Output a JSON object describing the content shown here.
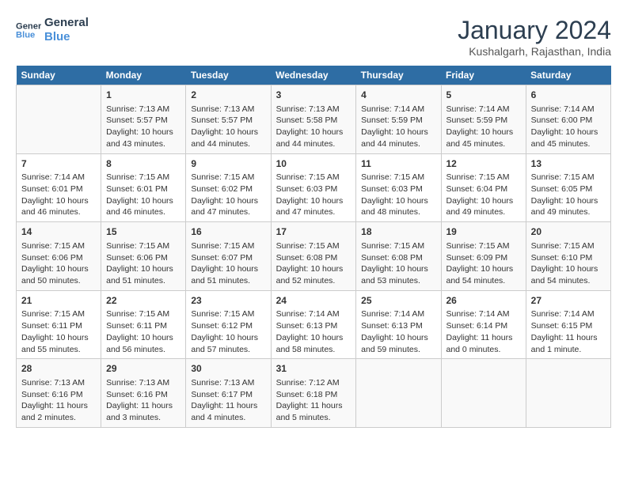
{
  "logo": {
    "line1": "General",
    "line2": "Blue"
  },
  "title": "January 2024",
  "subtitle": "Kushalgarh, Rajasthan, India",
  "days_of_week": [
    "Sunday",
    "Monday",
    "Tuesday",
    "Wednesday",
    "Thursday",
    "Friday",
    "Saturday"
  ],
  "weeks": [
    [
      {
        "day": "",
        "content": ""
      },
      {
        "day": "1",
        "content": "Sunrise: 7:13 AM\nSunset: 5:57 PM\nDaylight: 10 hours\nand 43 minutes."
      },
      {
        "day": "2",
        "content": "Sunrise: 7:13 AM\nSunset: 5:57 PM\nDaylight: 10 hours\nand 44 minutes."
      },
      {
        "day": "3",
        "content": "Sunrise: 7:13 AM\nSunset: 5:58 PM\nDaylight: 10 hours\nand 44 minutes."
      },
      {
        "day": "4",
        "content": "Sunrise: 7:14 AM\nSunset: 5:59 PM\nDaylight: 10 hours\nand 44 minutes."
      },
      {
        "day": "5",
        "content": "Sunrise: 7:14 AM\nSunset: 5:59 PM\nDaylight: 10 hours\nand 45 minutes."
      },
      {
        "day": "6",
        "content": "Sunrise: 7:14 AM\nSunset: 6:00 PM\nDaylight: 10 hours\nand 45 minutes."
      }
    ],
    [
      {
        "day": "7",
        "content": "Sunrise: 7:14 AM\nSunset: 6:01 PM\nDaylight: 10 hours\nand 46 minutes."
      },
      {
        "day": "8",
        "content": "Sunrise: 7:15 AM\nSunset: 6:01 PM\nDaylight: 10 hours\nand 46 minutes."
      },
      {
        "day": "9",
        "content": "Sunrise: 7:15 AM\nSunset: 6:02 PM\nDaylight: 10 hours\nand 47 minutes."
      },
      {
        "day": "10",
        "content": "Sunrise: 7:15 AM\nSunset: 6:03 PM\nDaylight: 10 hours\nand 47 minutes."
      },
      {
        "day": "11",
        "content": "Sunrise: 7:15 AM\nSunset: 6:03 PM\nDaylight: 10 hours\nand 48 minutes."
      },
      {
        "day": "12",
        "content": "Sunrise: 7:15 AM\nSunset: 6:04 PM\nDaylight: 10 hours\nand 49 minutes."
      },
      {
        "day": "13",
        "content": "Sunrise: 7:15 AM\nSunset: 6:05 PM\nDaylight: 10 hours\nand 49 minutes."
      }
    ],
    [
      {
        "day": "14",
        "content": "Sunrise: 7:15 AM\nSunset: 6:06 PM\nDaylight: 10 hours\nand 50 minutes."
      },
      {
        "day": "15",
        "content": "Sunrise: 7:15 AM\nSunset: 6:06 PM\nDaylight: 10 hours\nand 51 minutes."
      },
      {
        "day": "16",
        "content": "Sunrise: 7:15 AM\nSunset: 6:07 PM\nDaylight: 10 hours\nand 51 minutes."
      },
      {
        "day": "17",
        "content": "Sunrise: 7:15 AM\nSunset: 6:08 PM\nDaylight: 10 hours\nand 52 minutes."
      },
      {
        "day": "18",
        "content": "Sunrise: 7:15 AM\nSunset: 6:08 PM\nDaylight: 10 hours\nand 53 minutes."
      },
      {
        "day": "19",
        "content": "Sunrise: 7:15 AM\nSunset: 6:09 PM\nDaylight: 10 hours\nand 54 minutes."
      },
      {
        "day": "20",
        "content": "Sunrise: 7:15 AM\nSunset: 6:10 PM\nDaylight: 10 hours\nand 54 minutes."
      }
    ],
    [
      {
        "day": "21",
        "content": "Sunrise: 7:15 AM\nSunset: 6:11 PM\nDaylight: 10 hours\nand 55 minutes."
      },
      {
        "day": "22",
        "content": "Sunrise: 7:15 AM\nSunset: 6:11 PM\nDaylight: 10 hours\nand 56 minutes."
      },
      {
        "day": "23",
        "content": "Sunrise: 7:15 AM\nSunset: 6:12 PM\nDaylight: 10 hours\nand 57 minutes."
      },
      {
        "day": "24",
        "content": "Sunrise: 7:14 AM\nSunset: 6:13 PM\nDaylight: 10 hours\nand 58 minutes."
      },
      {
        "day": "25",
        "content": "Sunrise: 7:14 AM\nSunset: 6:13 PM\nDaylight: 10 hours\nand 59 minutes."
      },
      {
        "day": "26",
        "content": "Sunrise: 7:14 AM\nSunset: 6:14 PM\nDaylight: 11 hours\nand 0 minutes."
      },
      {
        "day": "27",
        "content": "Sunrise: 7:14 AM\nSunset: 6:15 PM\nDaylight: 11 hours\nand 1 minute."
      }
    ],
    [
      {
        "day": "28",
        "content": "Sunrise: 7:13 AM\nSunset: 6:16 PM\nDaylight: 11 hours\nand 2 minutes."
      },
      {
        "day": "29",
        "content": "Sunrise: 7:13 AM\nSunset: 6:16 PM\nDaylight: 11 hours\nand 3 minutes."
      },
      {
        "day": "30",
        "content": "Sunrise: 7:13 AM\nSunset: 6:17 PM\nDaylight: 11 hours\nand 4 minutes."
      },
      {
        "day": "31",
        "content": "Sunrise: 7:12 AM\nSunset: 6:18 PM\nDaylight: 11 hours\nand 5 minutes."
      },
      {
        "day": "",
        "content": ""
      },
      {
        "day": "",
        "content": ""
      },
      {
        "day": "",
        "content": ""
      }
    ]
  ]
}
